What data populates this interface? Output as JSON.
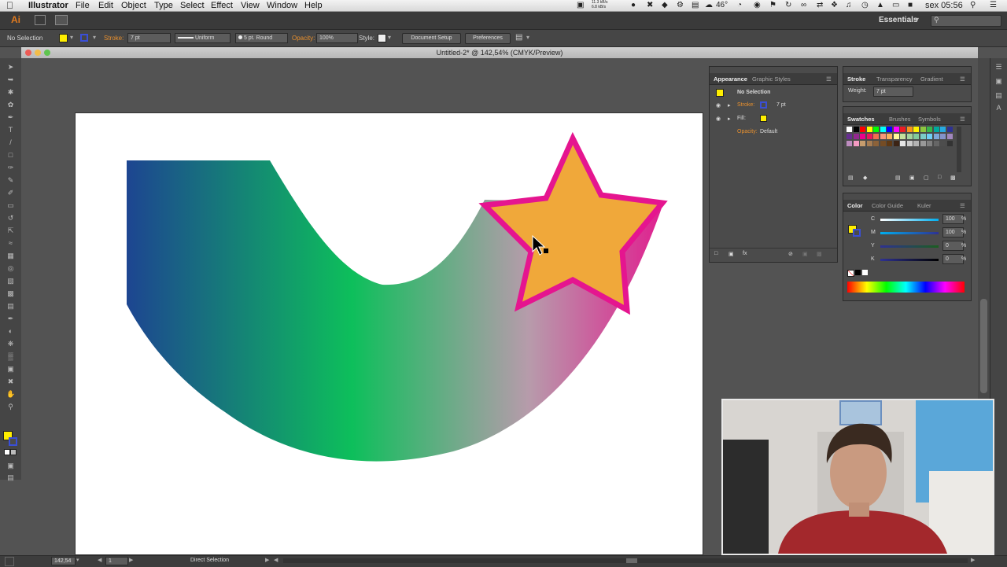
{
  "menubar": {
    "app_name": "Illustrator",
    "items": [
      "File",
      "Edit",
      "Object",
      "Type",
      "Select",
      "Effect",
      "View",
      "Window",
      "Help"
    ],
    "tray": {
      "network": "11.3 kB/s\n6.8 kB/s",
      "temperature": "46°",
      "clock": "sex 05:56"
    }
  },
  "appbar": {
    "logo": "Ai",
    "workspace": "Essentials",
    "search_placeholder": ""
  },
  "controlbar": {
    "selection": "No Selection",
    "stroke_label": "Stroke:",
    "stroke_weight": "7 pt",
    "profile": "Uniform",
    "brush": "5 pt. Round",
    "opacity_label": "Opacity:",
    "opacity": "100%",
    "style_label": "Style:",
    "document_setup": "Document Setup",
    "preferences": "Preferences",
    "fill_color": "#ffee00",
    "stroke_color": "#3a4fd6"
  },
  "document": {
    "title": "Untitled-2* @ 142,54% (CMYK/Preview)"
  },
  "appearance_panel": {
    "tabs": [
      "Appearance",
      "Graphic Styles"
    ],
    "header": "No Selection",
    "rows": [
      {
        "label": "Stroke:",
        "value": "7 pt"
      },
      {
        "label": "Fill:",
        "value": ""
      },
      {
        "label": "Opacity:",
        "value": "Default"
      }
    ]
  },
  "stroke_panel": {
    "tabs": [
      "Stroke",
      "Transparency",
      "Gradient"
    ],
    "weight_label": "Weight:",
    "weight": "7 pt"
  },
  "swatches_panel": {
    "tabs": [
      "Swatches",
      "Brushes",
      "Symbols"
    ]
  },
  "color_panel": {
    "tabs": [
      "Color",
      "Color Guide",
      "Kuler"
    ],
    "channels": [
      {
        "name": "C",
        "value": "100"
      },
      {
        "name": "M",
        "value": "100"
      },
      {
        "name": "Y",
        "value": "0"
      },
      {
        "name": "K",
        "value": "0"
      }
    ]
  },
  "statusbar": {
    "zoom": "142,54",
    "page": "1",
    "tool": "Direct Selection"
  },
  "colors": {
    "star_fill": "#f0a83a",
    "star_stroke": "#e5158f",
    "grad_blue": "#1d4591",
    "grad_green": "#0dbf5b",
    "grad_magenta": "#e01f8f"
  }
}
